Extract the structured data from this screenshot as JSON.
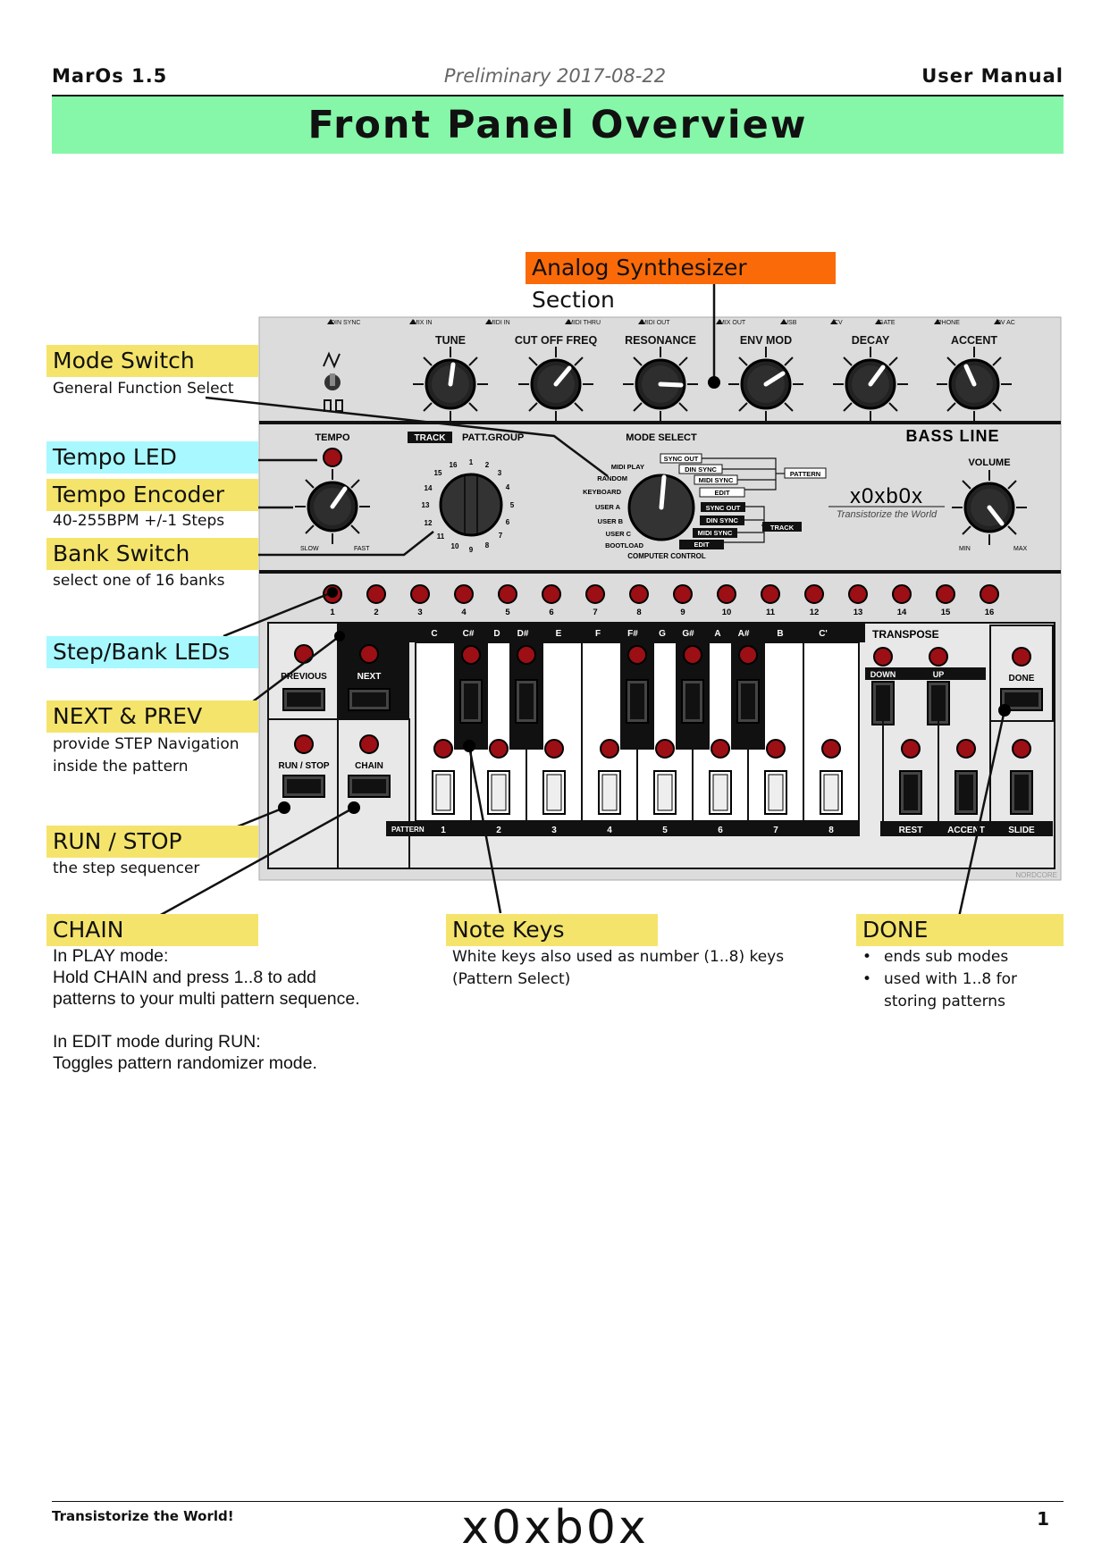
{
  "header": {
    "left": "MarOs 1.5",
    "center": "Preliminary 2017-08-22",
    "right": "User Manual"
  },
  "title": "Front Panel Overview",
  "callouts": {
    "analog": "Analog Synthesizer Section",
    "mode_switch": {
      "title": "Mode Switch",
      "sub": "General Function Select"
    },
    "tempo_led": {
      "title": "Tempo LED"
    },
    "tempo_encoder": {
      "title": "Tempo Encoder",
      "sub": "40-255BPM +/-1 Steps"
    },
    "bank_switch": {
      "title": "Bank Switch",
      "sub": "select one of 16 banks"
    },
    "step_leds": {
      "title": "Step/Bank LEDs"
    },
    "next_prev": {
      "title": "NEXT & PREV",
      "sub": [
        "provide STEP Navigation",
        "inside the pattern"
      ]
    },
    "run_stop": {
      "title": "RUN / STOP",
      "sub": "the step sequencer"
    },
    "chain": {
      "title": "CHAIN",
      "lines": [
        "In PLAY mode:",
        "Hold CHAIN and press 1..8 to add",
        "patterns to your multi pattern sequence.",
        "",
        "In EDIT mode during RUN:",
        "Toggles pattern randomizer mode."
      ]
    },
    "note_keys": {
      "title": "Note Keys",
      "sub": [
        "White keys also used as number (1..8) keys",
        "(Pattern Select)"
      ]
    },
    "done": {
      "title": "DONE",
      "bullets": [
        "ends sub modes",
        "used with 1..8 for storing patterns"
      ]
    }
  },
  "panel": {
    "jacks": [
      "DIN SYNC",
      "MIX IN",
      "MIDI IN",
      "MIDI THRU",
      "MIDI OUT",
      "MIX OUT",
      "USB",
      "CV",
      "GATE",
      "PHONE",
      "9V AC"
    ],
    "knobs": [
      "TUNE",
      "CUT OFF FREQ",
      "RESONANCE",
      "ENV MOD",
      "DECAY",
      "ACCENT"
    ],
    "tempo": {
      "label": "TEMPO",
      "slow": "SLOW",
      "fast": "FAST"
    },
    "track_label": "TRACK",
    "patt_group": "PATT.GROUP",
    "bank_numbers": [
      "1",
      "2",
      "3",
      "4",
      "5",
      "6",
      "7",
      "8",
      "9",
      "10",
      "11",
      "12",
      "13",
      "14",
      "15",
      "16"
    ],
    "mode_select": "MODE SELECT",
    "modes_left": [
      "MIDI PLAY",
      "RANDOM",
      "KEYBOARD",
      "USER A",
      "USER B",
      "USER C",
      "BOOTLOAD"
    ],
    "modes_right": [
      "SYNC OUT",
      "DIN SYNC",
      "MIDI SYNC",
      "EDIT",
      "SYNC OUT",
      "DIN SYNC",
      "MIDI SYNC",
      "EDIT"
    ],
    "mode_group_pattern": "PATTERN",
    "mode_group_track": "TRACK",
    "computer_control": "COMPUTER CONTROL",
    "brand": "BASS LINE",
    "logo": "x0xb0x",
    "tagline": "Transistorize the World",
    "volume": {
      "label": "VOLUME",
      "min": "MIN",
      "max": "MAX"
    },
    "steps": [
      "1",
      "2",
      "3",
      "4",
      "5",
      "6",
      "7",
      "8",
      "9",
      "10",
      "11",
      "12",
      "13",
      "14",
      "15",
      "16"
    ],
    "notes": [
      "C",
      "C#",
      "D",
      "D#",
      "E",
      "F",
      "F#",
      "G",
      "G#",
      "A",
      "A#",
      "B",
      "C'"
    ],
    "previous": "PREVIOUS",
    "next": "NEXT",
    "run_stop": "RUN / STOP",
    "chain": "CHAIN",
    "transpose": "TRANSPOSE",
    "down": "DOWN",
    "up": "UP",
    "done": "DONE",
    "pattern_label": "PATTERN",
    "pattern_numbers": [
      "1",
      "2",
      "3",
      "4",
      "5",
      "6",
      "7",
      "8"
    ],
    "rest": "REST",
    "accent": "ACCENT",
    "slide": "SLIDE",
    "credit": "NORDCORE"
  },
  "footer": {
    "left": "Transistorize the World!",
    "center": "x0xb0x",
    "page": "1"
  }
}
